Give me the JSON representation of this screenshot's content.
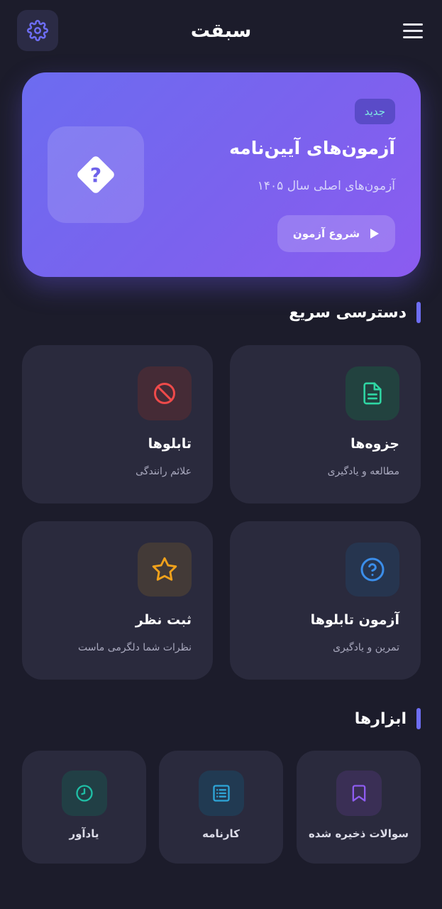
{
  "header": {
    "title": "سبقت",
    "menu_icon": "menu-icon",
    "settings_icon": "gear-icon"
  },
  "hero": {
    "badge": "جدید",
    "title": "آزمون‌های آیین‌نامه",
    "subtitle": "آزمون‌های اصلی سال ۱۴۰۵",
    "button_label": "شروع آزمون",
    "icon": "question-diamond-icon"
  },
  "quick_access": {
    "title": "دسترسی سریع",
    "cards": [
      {
        "title": "جزوه‌ها",
        "subtitle": "مطالعه و یادگیری",
        "icon": "document-icon"
      },
      {
        "title": "تابلوها",
        "subtitle": "علائم رانندگی",
        "icon": "no-entry-icon"
      },
      {
        "title": "آزمون تابلوها",
        "subtitle": "تمرین و یادگیری",
        "icon": "question-circle-icon"
      },
      {
        "title": "ثبت نظر",
        "subtitle": "نظرات شما دلگرمی ماست",
        "icon": "star-icon"
      }
    ]
  },
  "tools": {
    "title": "ابزارها",
    "items": [
      {
        "label": "سوالات ذخیره شده",
        "icon": "bookmark-icon"
      },
      {
        "label": "کارنامه",
        "icon": "list-icon"
      },
      {
        "label": "یادآور",
        "icon": "clock-icon"
      }
    ]
  },
  "colors": {
    "background": "#1c1c2b",
    "card": "#2a2a3d",
    "accent": "#6e6ef5",
    "badge_text": "#7fe9e2"
  }
}
